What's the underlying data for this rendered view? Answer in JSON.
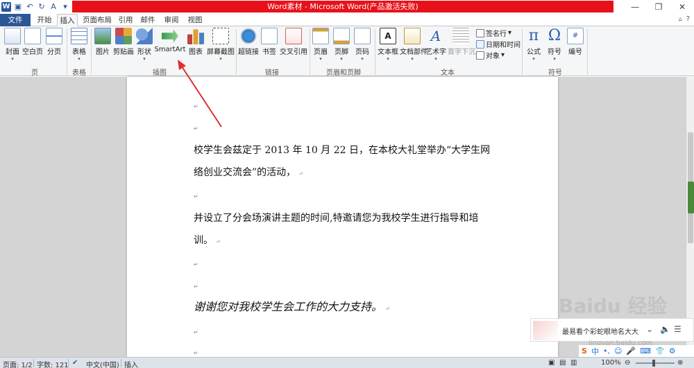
{
  "title_bar": {
    "title": "Word素材  -  Microsoft Word(产品激活失败)",
    "controls": [
      "minimize-icon",
      "restore-icon",
      "close-icon"
    ]
  },
  "tabs": [
    "文件",
    "开始",
    "插入",
    "页面布局",
    "引用",
    "邮件",
    "审阅",
    "视图"
  ],
  "active_tab": "插入",
  "ribbon": {
    "pages": {
      "cover": "封面",
      "blank": "空白页",
      "break": "分页",
      "label": "页"
    },
    "tables": {
      "table": "表格",
      "label": "表格"
    },
    "illustrations": {
      "picture": "图片",
      "clipart": "剪贴画",
      "shapes": "形状",
      "smartart": "SmartArt",
      "chart": "图表",
      "screenshot": "屏幕截图",
      "label": "插图"
    },
    "links": {
      "hyperlink": "超链接",
      "bookmark": "书签",
      "crossref": "交叉引用",
      "label": "链接"
    },
    "header_footer": {
      "header": "页眉",
      "footer": "页脚",
      "page_number": "页码",
      "label": "页眉和页脚"
    },
    "text": {
      "textbox": "文本框",
      "quickparts": "文档部件",
      "wordart": "艺术字",
      "dropcap": "首字下沉",
      "signature": "签名行",
      "datetime": "日期和时间",
      "object": "对象",
      "label": "文本"
    },
    "symbols": {
      "equation": "公式",
      "symbol": "符号",
      "number": "编号",
      "label": "符号"
    }
  },
  "document": {
    "para1_line1": "校学生会兹定于 2013 年 10 月 22 日，在本校大礼堂举办“大学生网",
    "para1_line2": "络创业交流会”的活动，",
    "para2_line1": "并设立了分会场演讲主题的时间,特邀请您为我校学生进行指导和培",
    "para2_line2": "训。",
    "para3": "谢谢您对我校学生会工作的大力支持。",
    "para_mark": "↵"
  },
  "status_bar": {
    "page": "页面: 1/2",
    "words": "字数: 121",
    "language": "中文(中国)",
    "mode": "插入",
    "zoom": "100%"
  },
  "overlay": {
    "ime_text": "最易看个彩蛇眼地名大大",
    "ime_label": "中",
    "watermark": "Baidu 经验",
    "watermark_url": "jingyan.baidu.com"
  },
  "colors": {
    "title_red": "#e8111a",
    "file_tab": "#2b5797",
    "arrow": "#e03030"
  }
}
